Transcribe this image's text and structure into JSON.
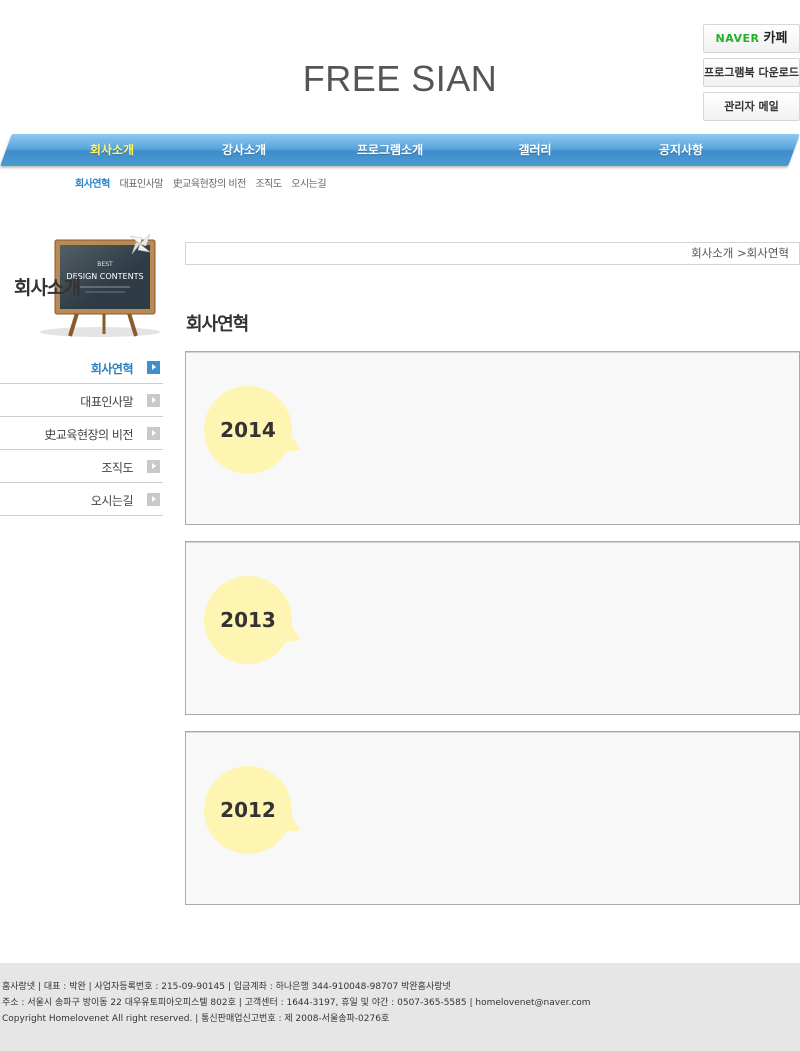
{
  "site": {
    "logo": "FREE SIAN"
  },
  "quick_links": {
    "cafe_naver": "NAVER",
    "cafe_label": "카페",
    "program_book": "프로그램북 다운로드",
    "admin_mail": "관리자 메일"
  },
  "gnb": {
    "items": [
      {
        "label": "회사소개",
        "active": true
      },
      {
        "label": "강사소개"
      },
      {
        "label": "프로그램소개"
      },
      {
        "label": "갤러리"
      },
      {
        "label": "공지사항"
      }
    ]
  },
  "subnav": {
    "items": [
      {
        "label": "회사연혁",
        "active": true
      },
      {
        "label": "대표인사말"
      },
      {
        "label": "史교육현장의 비전"
      },
      {
        "label": "조직도"
      },
      {
        "label": "오시는길"
      }
    ]
  },
  "sidebar": {
    "title": "회사소개",
    "board_text": {
      "line1": "BEST",
      "line2": "DESIGN CONTENTS"
    },
    "items": [
      {
        "label": "회사연혁",
        "active": true
      },
      {
        "label": "대표인사말"
      },
      {
        "label": "史교육현장의 비전"
      },
      {
        "label": "조직도"
      },
      {
        "label": "오시는길"
      }
    ]
  },
  "main": {
    "location": "회사소개 >회사연혁",
    "title": "회사연혁",
    "years": [
      "2014",
      "2013",
      "2012"
    ]
  },
  "footer": {
    "line1": "홈사랑넷 | 대표 : 박완 | 사업자등록번호 : 215-09-90145 | 입금계좌 : 하나은행 344-910048-98707 박완홈사랑넷",
    "line2": "주소 : 서울시 송파구 방이동 22 대우유토피아오피스텔 802호 | 고객센터 : 1644-3197, 휴일 및 야간 : 0507-365-5585 | homelovenet@naver.com",
    "line3": "Copyright Homelovenet All right reserved. | 통신판매업신고번호 : 제 2008-서울송파-0276호"
  },
  "colors": {
    "gnb_blue": "#4c9ad3",
    "active_yellow": "#fff36a",
    "bubble": "#fff5b3",
    "accent_blue": "#2a86c5"
  }
}
